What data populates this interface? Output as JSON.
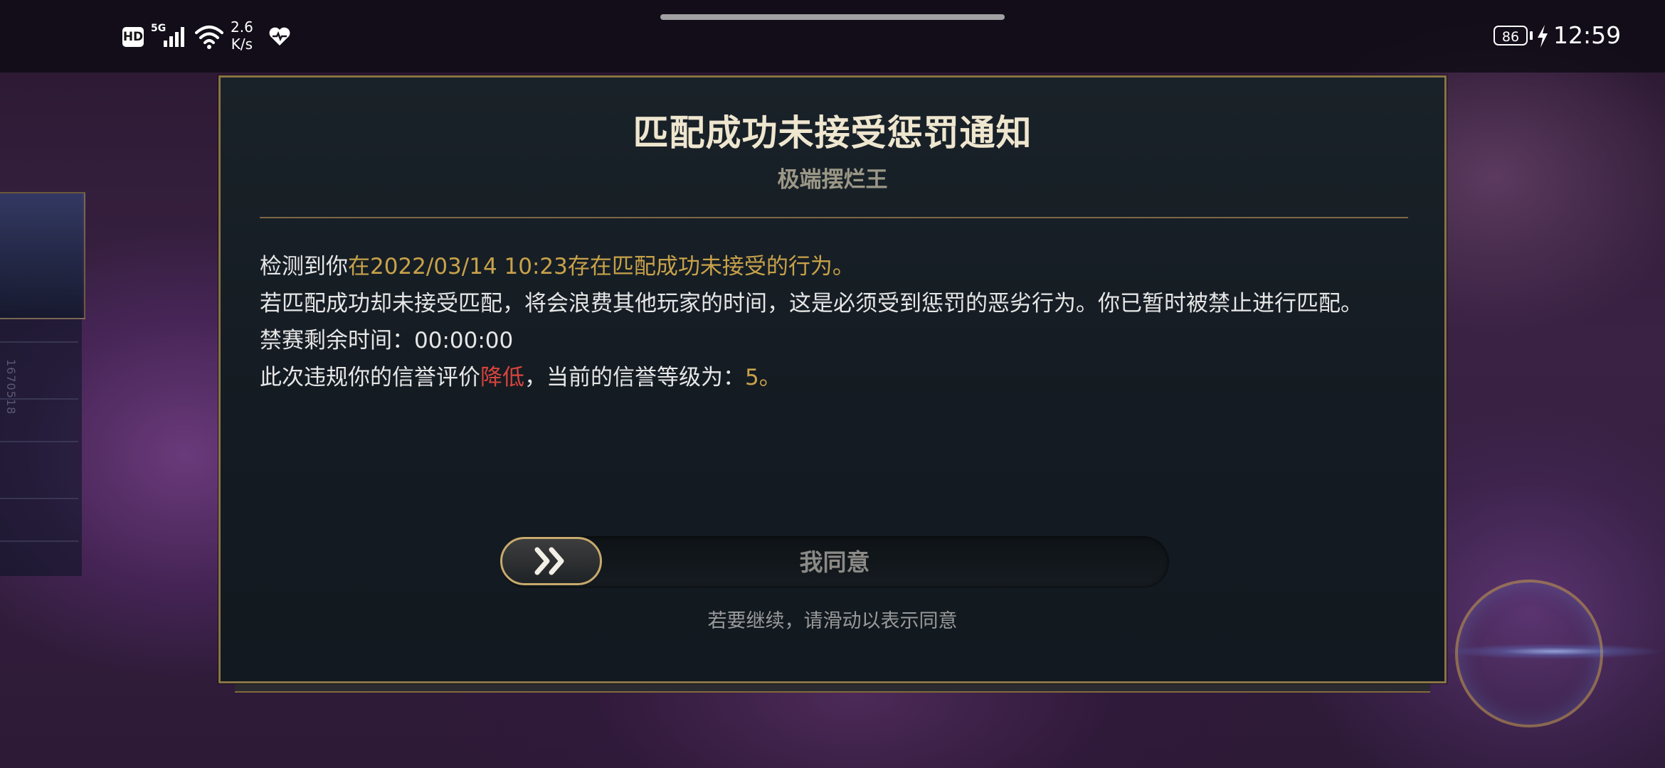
{
  "status_bar": {
    "hd_label": "HD",
    "network_label": "5G",
    "net_speed_value": "2.6",
    "net_speed_unit": "K/s",
    "battery_level": "86",
    "time": "12:59"
  },
  "background": {
    "side_id": "1670518"
  },
  "dialog": {
    "title": "匹配成功未接受惩罚通知",
    "subtitle": "极端摆烂王",
    "line1_prefix": "检测到你",
    "line1_highlight": "在2022/03/14 10:23存在匹配成功未接受的行为。",
    "line2": "若匹配成功却未接受匹配，将会浪费其他玩家的时间，这是必须受到惩罚的恶劣行为。你已暂时被禁止进行匹配。",
    "line3": "禁赛剩余时间：00:00:00",
    "line4_prefix": "此次违规你的信誉评价",
    "line4_red": "降低",
    "line4_middle": "，当前的信誉等级为：",
    "line4_value": "5。",
    "slider_label": "我同意",
    "hint": "若要继续，请滑动以表示同意"
  },
  "colors": {
    "gold_accent": "#c8a24a",
    "red_accent": "#d8443c",
    "border": "#8a7446",
    "knob_border": "#c7aa6d"
  },
  "icons": {
    "slider_knob": "double-chevron-right-icon",
    "status": [
      "hd-icon",
      "signal-icon",
      "wifi-icon",
      "heart-icon",
      "battery-icon",
      "charging-bolt-icon"
    ]
  }
}
